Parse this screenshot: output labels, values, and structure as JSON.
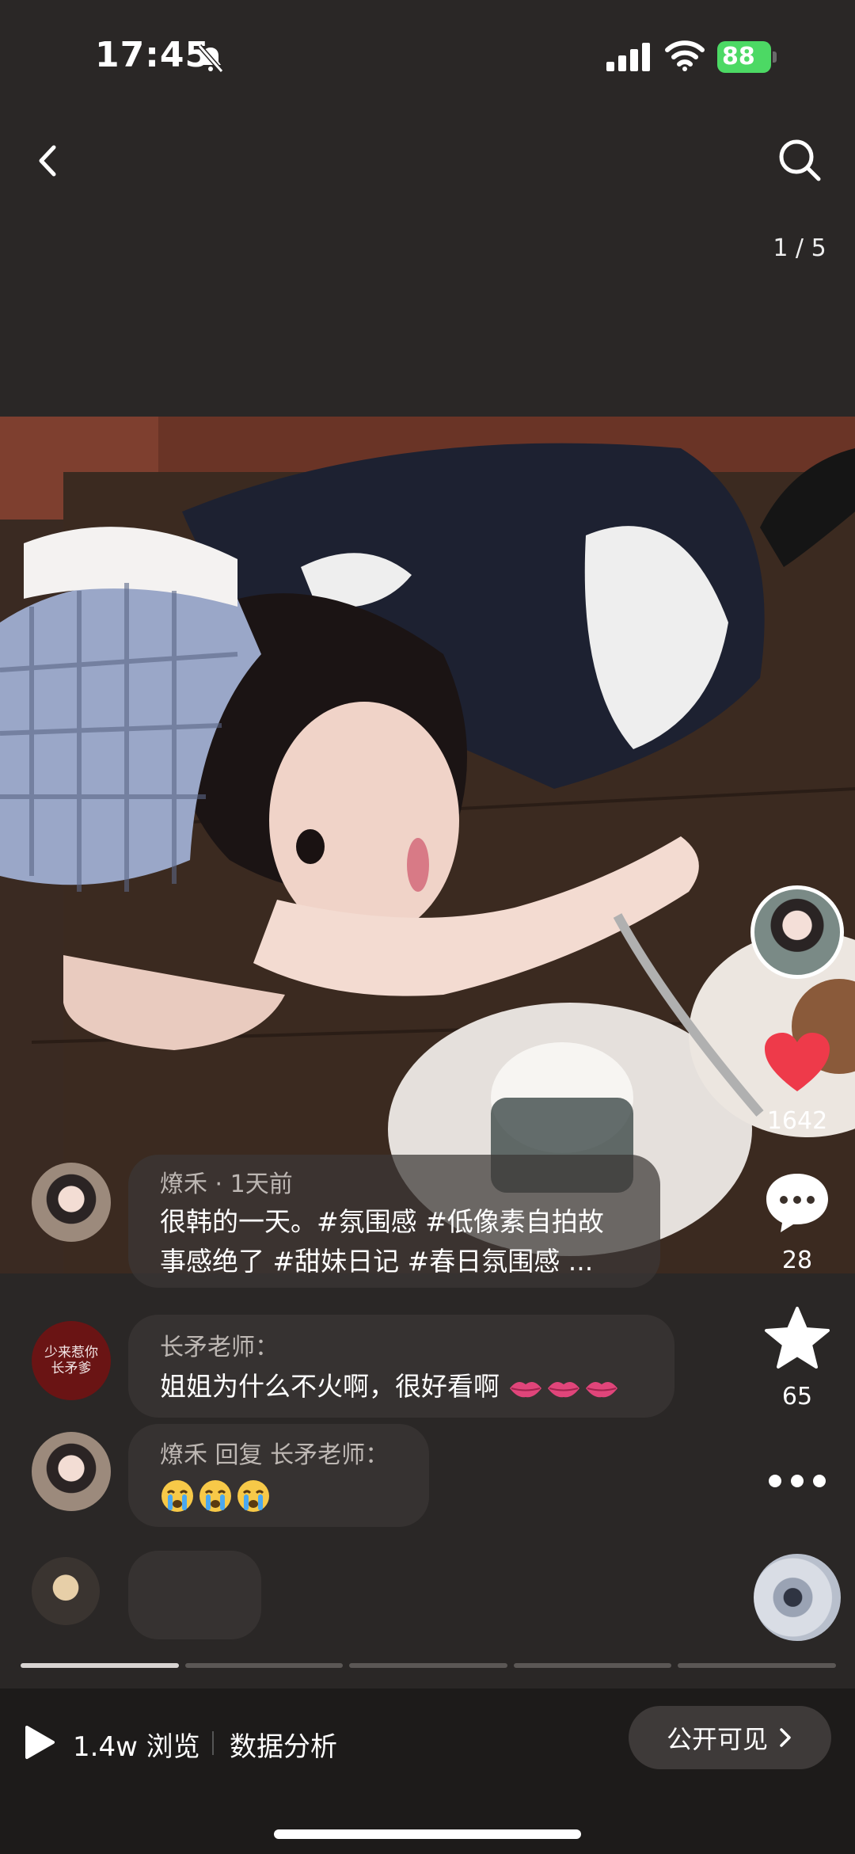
{
  "status_bar": {
    "time": "17:45",
    "battery": "88"
  },
  "nav": {
    "page_counter": "1 / 5"
  },
  "post": {
    "author": "燎禾",
    "time_ago": "1天前",
    "meta": "燎禾 · 1天前",
    "caption_line1": "很韩的一天。#氛围感 #低像素自拍故",
    "caption_line2": "事感绝了 #甜妹日记 #春日氛围感 ..."
  },
  "actions": {
    "likes": "1642",
    "comments": "28",
    "favorites": "65"
  },
  "comments": [
    {
      "name": "长矛老师：",
      "text": "姐姐为什么不火啊，很好看啊",
      "avatar_text_line1": "少来惹你",
      "avatar_text_line2": "长矛爹"
    },
    {
      "name": "燎禾 回复 长矛老师：",
      "text": ""
    }
  ],
  "footer": {
    "views": "1.4w 浏览",
    "analysis": "数据分析",
    "visibility": "公开可见"
  },
  "colors": {
    "like": "#ee3a4a",
    "battery": "#4cd964",
    "bottom_bar": "#1d1b1a"
  },
  "icons": [
    "back-icon",
    "search-icon",
    "heart-icon",
    "comment-icon",
    "star-icon",
    "more-icon",
    "play-icon",
    "chevron-right-icon",
    "bell-off-icon",
    "signal-icon",
    "wifi-icon"
  ]
}
